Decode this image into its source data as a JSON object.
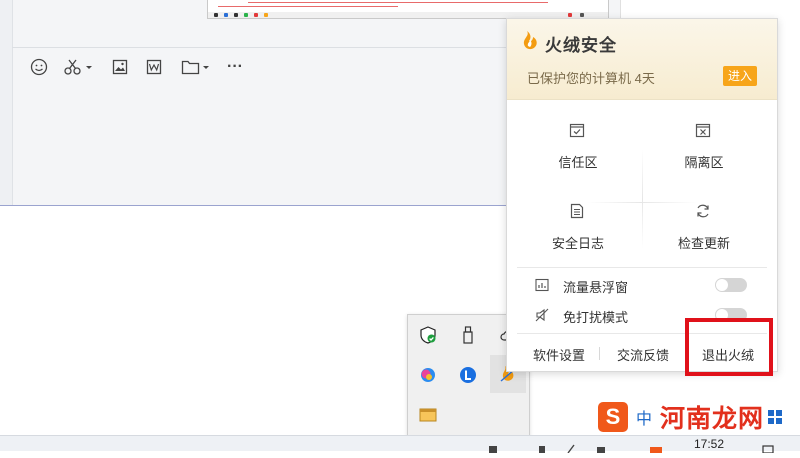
{
  "toolbar": {
    "items": [
      "emoji-icon",
      "scissors-icon",
      "image-icon",
      "word-doc-icon",
      "folder-icon",
      "more-icon"
    ],
    "more_label": "···"
  },
  "popup": {
    "brand": "火绒安全",
    "status": "已保护您的计算机 4天",
    "enter_label": "进入",
    "grid": [
      {
        "label": "信任区",
        "icon": "trust-zone-icon"
      },
      {
        "label": "隔离区",
        "icon": "quarantine-icon"
      },
      {
        "label": "安全日志",
        "icon": "security-log-icon"
      },
      {
        "label": "检查更新",
        "icon": "refresh-icon"
      }
    ],
    "toggles": [
      {
        "label": "流量悬浮窗",
        "icon": "traffic-chart-icon",
        "on": false
      },
      {
        "label": "免打扰模式",
        "icon": "mute-icon",
        "on": false
      }
    ],
    "footer": {
      "settings": "软件设置",
      "feedback": "交流反馈",
      "exit": "退出火绒"
    },
    "colors": {
      "accent": "#f7a51a",
      "highlight": "#e0111a"
    }
  },
  "taskbar": {
    "time": "17:52"
  },
  "tray": {
    "icons": [
      "shield-check-icon",
      "usb-drive-icon",
      "cloud-icon",
      "color-app-icon",
      "l-badge-icon",
      "huorong-tray-icon",
      "window-app-icon"
    ]
  },
  "watermark": {
    "logo_letter": "S",
    "zh": "中",
    "text": "河南龙网"
  }
}
